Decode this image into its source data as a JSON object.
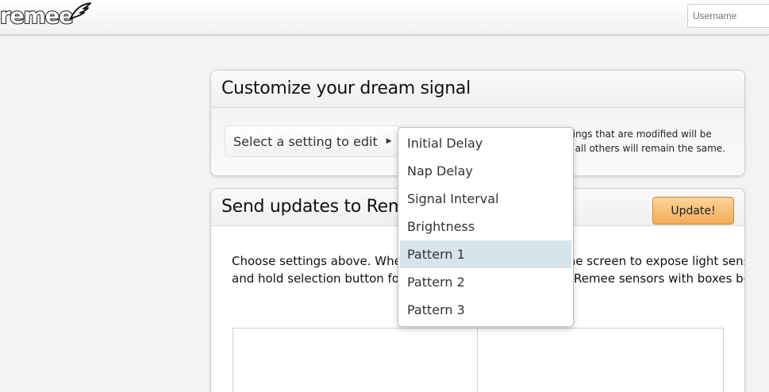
{
  "header": {
    "logo_text": "remee",
    "username_placeholder": "Username"
  },
  "customize": {
    "title": "Customize your dream signal",
    "select_label": "Select a setting to edit",
    "hint_line1": "tings that are modified will be",
    "hint_line2": ", all others will remain the same."
  },
  "send": {
    "title": "Send updates to Remee",
    "update_label": "Update!",
    "body_line1": "Choose settings above. When ready, hold Remee up to the screen to expose light sensors, press",
    "body_line2": "and hold selection button for 2 seconds, then line up the Remee sensors with boxes below"
  },
  "dropdown": {
    "items": [
      "Initial Delay",
      "Nap Delay",
      "Signal Interval",
      "Brightness",
      "Pattern 1",
      "Pattern 2",
      "Pattern 3"
    ],
    "highlighted": "Pattern 1"
  },
  "colors": {
    "update_button": "#f5ab54",
    "highlight": "#d7e4ec"
  }
}
